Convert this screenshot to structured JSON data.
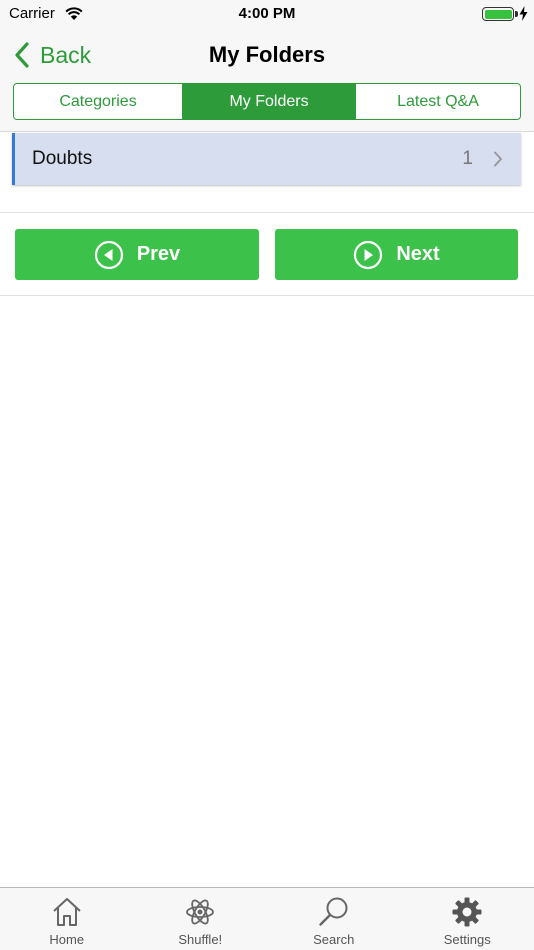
{
  "status_bar": {
    "carrier": "Carrier",
    "time": "4:00 PM",
    "battery_level": 1.0,
    "icons": [
      "wifi-icon",
      "battery-icon",
      "charging-bolt-icon"
    ]
  },
  "nav": {
    "back_label": "Back",
    "title": "My Folders"
  },
  "segments": [
    {
      "label": "Categories",
      "active": false
    },
    {
      "label": "My Folders",
      "active": true
    },
    {
      "label": "Latest Q&A",
      "active": false
    }
  ],
  "folders": [
    {
      "name": "Doubts",
      "count": "1"
    }
  ],
  "pager": {
    "prev_label": "Prev",
    "next_label": "Next"
  },
  "tabs": [
    {
      "label": "Home",
      "icon": "home-icon"
    },
    {
      "label": "Shuffle!",
      "icon": "atom-icon"
    },
    {
      "label": "Search",
      "icon": "search-icon"
    },
    {
      "label": "Settings",
      "icon": "gear-icon"
    }
  ],
  "colors": {
    "accent_green": "#2e9b3a",
    "button_green": "#3cc24a",
    "row_background": "#d6deef",
    "row_accent_blue": "#3a78d8"
  }
}
